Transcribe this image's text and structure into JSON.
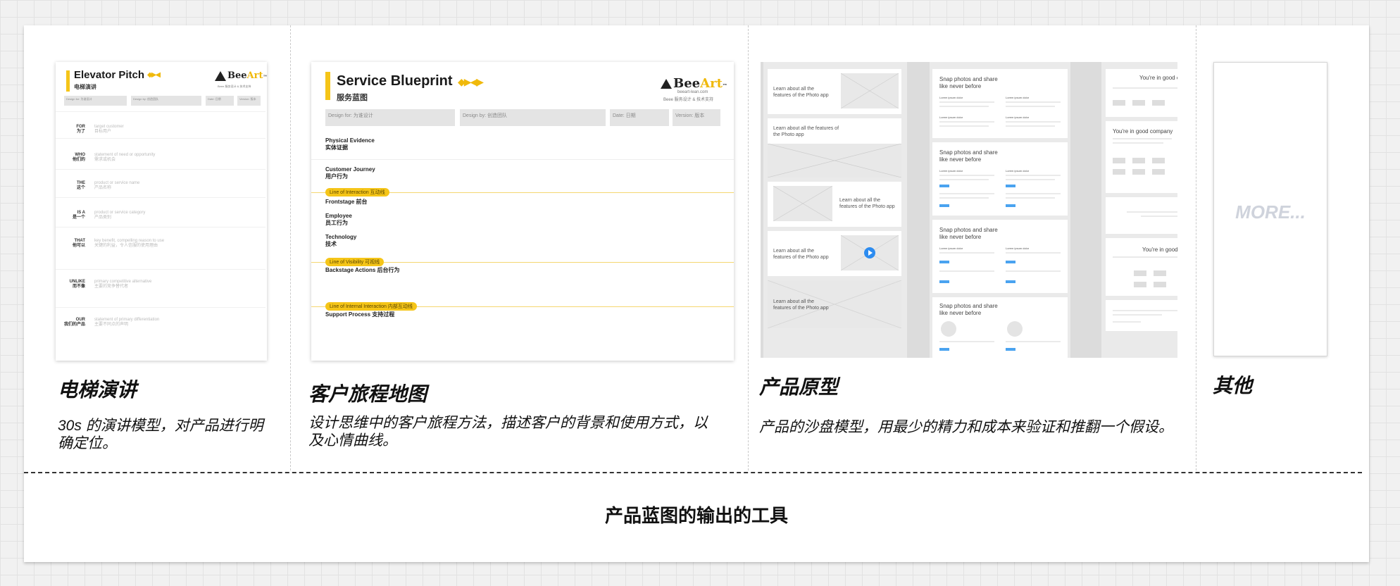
{
  "footer_caption": "产品蓝图的输出的工具",
  "columns": [
    {
      "title": "电梯演讲",
      "desc_line1": "30s 的演讲模型，对产品进行明",
      "desc_line2": "确定位。"
    },
    {
      "title": "客户旅程地图",
      "desc_line1": "设计思维中的客户旅程方法，描述客户的背景和使用方式，以",
      "desc_line2": "及心情曲线。"
    },
    {
      "title": "产品原型",
      "desc_line1": "产品的沙盘模型，用最少的精力和成本来验证和推翻一个假设。",
      "desc_line2": ""
    },
    {
      "title": "其他",
      "desc_line1": "",
      "desc_line2": ""
    }
  ],
  "elevator": {
    "title": "Elevator Pitch",
    "subtitle": "电梯演讲",
    "arrows": "◆▶◀",
    "headers": [
      "Design for: 为谁设计",
      "Design by: 创造团队",
      "Date: 日期",
      "Version: 版本"
    ],
    "rows": [
      {
        "en": "FOR",
        "cn": "为了",
        "hint_en": "target customer",
        "hint_cn": "目标用户"
      },
      {
        "en": "WHO",
        "cn": "他们的",
        "hint_en": "statement of need or opportunity",
        "hint_cn": "需求或机会"
      },
      {
        "en": "THE",
        "cn": "这个",
        "hint_en": "product or service name",
        "hint_cn": "产品名称"
      },
      {
        "en": "IS A",
        "cn": "是一个",
        "hint_en": "product or service category",
        "hint_cn": "产品类别"
      },
      {
        "en": "THAT",
        "cn": "他可以",
        "hint_en": "key benefit, compelling reason to use",
        "hint_cn": "关键的利益，令人信服的使用理由"
      },
      {
        "en": "UNLIKE",
        "cn": "而不像",
        "hint_en": "primary competitive alternative",
        "hint_cn": "主要的竞争替代者"
      },
      {
        "en": "OUR",
        "cn": "我们的产品",
        "hint_en": "statement of primary differentiation",
        "hint_cn": "主要不同点的声明"
      }
    ]
  },
  "blueprint": {
    "title": "Service Blueprint",
    "subtitle": "服务蓝图",
    "arrows": "◆▶◀▶",
    "headers": [
      "Design for: 为谁设计",
      "Design by: 创造团队",
      "Date: 日期",
      "Version: 版本"
    ],
    "rows": [
      {
        "en": "Physical Evidence",
        "cn": "实体证据"
      },
      {
        "en": "Customer Journey",
        "cn": "用户行为"
      },
      {
        "en": "Frontstage 前台",
        "cn": ""
      },
      {
        "en": "Employee",
        "cn": "员工行为"
      },
      {
        "en": "Technology",
        "cn": "技术"
      },
      {
        "en": "Backstage Actions 后台行为",
        "cn": ""
      },
      {
        "en": "Support Process 支持过程",
        "cn": ""
      }
    ],
    "pills": [
      "Line of Interaction 互动线",
      "Line of Visibility 可视线",
      "Line of Internal Interaction 内部互动线"
    ]
  },
  "logo": {
    "brand": "Bee",
    "accent": "Art",
    "tm": "™",
    "site": "beeart-lean.com",
    "tagline": "Beee 服务设计 & 技术支持"
  },
  "prototype": {
    "col1_cards": [
      "Learn about all the features of the Photo app",
      "Learn about all the features of the Photo app",
      "Learn about all the features of the Photo app",
      "Learn about all the features of the Photo app",
      "Learn about all the features of the Photo app"
    ],
    "col2_heading": "Snap photos and share like never before",
    "col2_labels": [
      "Lorem ipsum dolor",
      "Lorem ipsum dolor",
      "Lorem ipsum dolor",
      "Lorem ipsum dolor"
    ],
    "col3_texts": [
      "You're in good co",
      "You're in good company",
      "You're in good c"
    ]
  },
  "more_text": "MORE..."
}
